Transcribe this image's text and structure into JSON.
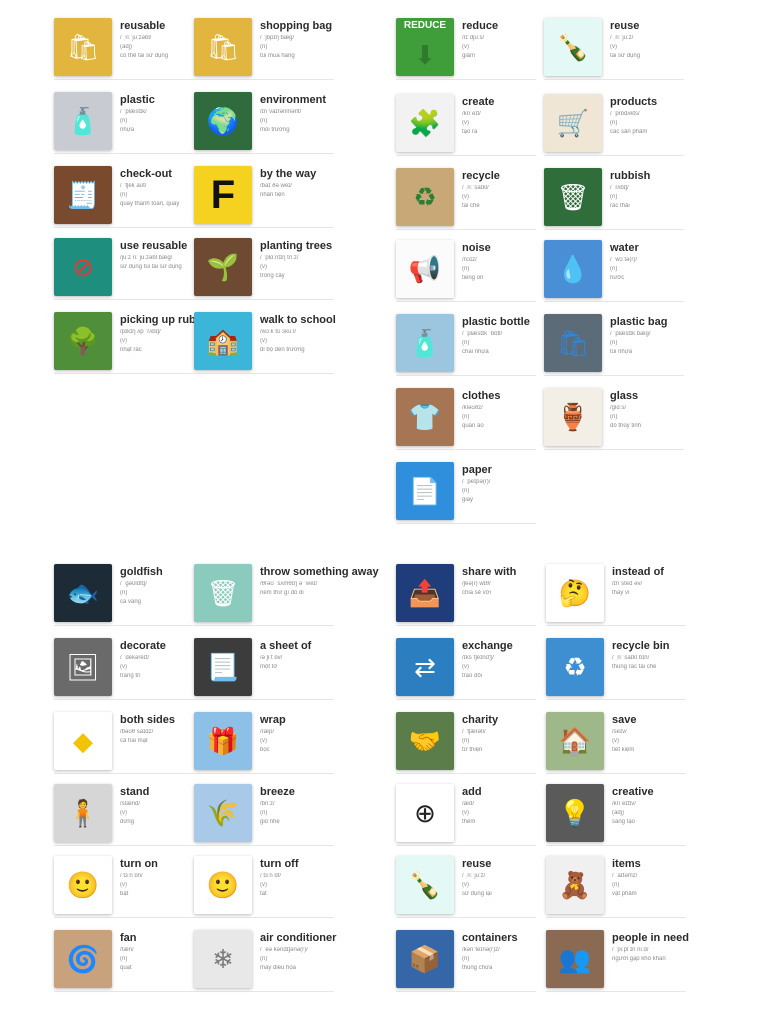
{
  "sections": [
    {
      "name": "section-top-left",
      "cards": [
        {
          "word": "reusable",
          "ipa": "/ ˌriːˈjuːzəbl/",
          "pos": "(adj)",
          "meaning": "có thể tái sử dụng",
          "icon": "shopping-bags-icon",
          "color": "#e2b53e",
          "glyph": "🛍",
          "glyph_color": "#ffffff"
        },
        {
          "word": "shopping bag",
          "ipa": "/ ˈʃɒpɪŋ bæɡ/",
          "pos": "(n)",
          "meaning": "túi mua hàng",
          "icon": "shopping-bags-icon",
          "color": "#e2b53e",
          "glyph": "🛍",
          "glyph_color": "#ffffff"
        },
        {
          "word": "plastic",
          "ipa": "/ ˈplæstɪk/",
          "pos": "(n)",
          "meaning": "nhựa",
          "icon": "plastic-bottles-icon",
          "color": "#c8ccd2",
          "glyph": "🧴",
          "glyph_color": "#3a7bd5"
        },
        {
          "word": "environment",
          "ipa": "/ɪnˈvaɪrənmənt/",
          "pos": "(n)",
          "meaning": "môi trường",
          "icon": "earth-icon",
          "color": "#2f6b3c",
          "glyph": "🌍",
          "glyph_color": "#7fc4ff"
        },
        {
          "word": "check-out",
          "ipa": "/ ˈtʃek aʊt/",
          "pos": "(n)",
          "meaning": "quầy thanh toán, quầy",
          "icon": "checkout-counter-icon",
          "color": "#7a4a2e",
          "glyph": "🧾",
          "glyph_color": "#ffffff"
        },
        {
          "word": "by the way",
          "ipa": "/baɪ ðə weɪ/",
          "pos": "",
          "meaning": "nhân tiện",
          "icon": "letter-f-icon",
          "color": "#f5d21f",
          "glyph": "F",
          "glyph_color": "#111111"
        },
        {
          "word": "use reusable",
          "ipa": "/juːz riːˈjuːzəbl bæɡ/",
          "pos": "",
          "meaning": "sử dụng túi tái sử dụng",
          "icon": "no-plastic-bag-icon",
          "color": "#1e8f7e",
          "glyph": "⊘",
          "glyph_color": "#e53935"
        },
        {
          "word": "planting trees",
          "ipa": "/ ˈplɑːntɪŋ triːz/",
          "pos": "(v)",
          "meaning": "trồng cây",
          "icon": "seedling-icon",
          "color": "#6e4a32",
          "glyph": "🌱",
          "glyph_color": "#6ccf4a"
        },
        {
          "word": "picking up rubbish",
          "ipa": "/pɪkɪŋ ʌp ˈrʌbɪʃ/",
          "pos": "(v)",
          "meaning": "nhặt rác",
          "icon": "park-cleanup-icon",
          "color": "#4f8f3a",
          "glyph": "🌳",
          "glyph_color": "#2e6d22"
        },
        {
          "word": "walk to school",
          "ipa": "/wɔːk tʊ skuːl/",
          "pos": "(v)",
          "meaning": "đi bộ đến trường",
          "icon": "school-children-icon",
          "color": "#3bb5d8",
          "glyph": "🏫",
          "glyph_color": "#ffffff"
        }
      ]
    },
    {
      "name": "section-top-right",
      "cards": [
        {
          "word": "reduce",
          "ipa": "/rɪˈdjuːs/",
          "pos": "(v)",
          "meaning": "giảm",
          "icon": "reduce-arrow-icon",
          "color": "#3f9e3a",
          "glyph": "⬇",
          "glyph_color": "#2f7a2c",
          "label": "REDUCE"
        },
        {
          "word": "reuse",
          "ipa": "/ ˌriːˈjuːz/",
          "pos": "(v)",
          "meaning": "tái sử dụng",
          "icon": "green-bottle-icon",
          "color": "#e4f8f5",
          "glyph": "🍾",
          "glyph_color": "#2e8b57"
        },
        {
          "word": "create",
          "ipa": "/kriˈeɪt/",
          "pos": "(v)",
          "meaning": "tạo ra",
          "icon": "puzzle-icon",
          "color": "#f2f2f2",
          "glyph": "🧩",
          "glyph_color": "#2a9fd6"
        },
        {
          "word": "products",
          "ipa": "/ ˈprɒdʌkts/",
          "pos": "(n)",
          "meaning": "các sản phẩm",
          "icon": "products-icon",
          "color": "#efe6d6",
          "glyph": "🛒",
          "glyph_color": "#c0392b"
        },
        {
          "word": "recycle",
          "ipa": "/ ˌriːˈsaɪkl/",
          "pos": "(v)",
          "meaning": "tái chế",
          "icon": "recycle-box-icon",
          "color": "#c9a878",
          "glyph": "♻",
          "glyph_color": "#2e7d32"
        },
        {
          "word": "rubbish",
          "ipa": "/ ˈrʌbɪʃ/",
          "pos": "(n)",
          "meaning": "rác thải",
          "icon": "trash-bins-icon",
          "color": "#2f6d3a",
          "glyph": "🗑",
          "glyph_color": "#ffffff"
        },
        {
          "word": "noise",
          "ipa": "/nɔɪz/",
          "pos": "(n)",
          "meaning": "tiếng ồn",
          "icon": "noise-icon",
          "color": "#fbfbfb",
          "glyph": "📢",
          "glyph_color": "#e53935"
        },
        {
          "word": "water",
          "ipa": "/ ˈwɔːtə(r)/",
          "pos": "(n)",
          "meaning": "nước",
          "icon": "water-splash-icon",
          "color": "#4a8fd6",
          "glyph": "💧",
          "glyph_color": "#ffffff"
        },
        {
          "word": "plastic bottle",
          "ipa": "/ ˈplæstɪk ˈbɒtl/",
          "pos": "(n)",
          "meaning": "chai nhựa",
          "icon": "plastic-bottle-icon",
          "color": "#9cc6e0",
          "glyph": "🧴",
          "glyph_color": "#ffffff"
        },
        {
          "word": "plastic bag",
          "ipa": "/ ˈplæstɪk bæɡ/",
          "pos": "(n)",
          "meaning": "túi nhựa",
          "icon": "plastic-bag-icon",
          "color": "#5b6b78",
          "glyph": "🛍",
          "glyph_color": "#2e86de"
        },
        {
          "word": "clothes",
          "ipa": "/kləʊðz/",
          "pos": "(n)",
          "meaning": "quần áo",
          "icon": "clothes-icon",
          "color": "#a67654",
          "glyph": "👕",
          "glyph_color": "#ffffff"
        },
        {
          "word": "glass",
          "ipa": "/ɡlɑːs/",
          "pos": "(n)",
          "meaning": "đồ thủy tinh",
          "icon": "glass-jars-icon",
          "color": "#f3efe6",
          "glyph": "🏺",
          "glyph_color": "#b59a72"
        },
        {
          "word": "paper",
          "ipa": "/ ˈpeɪpə(r)/",
          "pos": "(n)",
          "meaning": "giấy",
          "icon": "paper-stack-icon",
          "color": "#2f8fdc",
          "glyph": "📄",
          "glyph_color": "#ffffff"
        }
      ]
    },
    {
      "name": "section-bottom-left",
      "cards": [
        {
          "word": "goldfish",
          "ipa": "/ ˈɡəʊldfɪʃ/",
          "pos": "(n)",
          "meaning": "cá vàng",
          "icon": "goldfish-icon",
          "color": "#1d2b36",
          "glyph": "🐟",
          "glyph_color": "#ff8c1a"
        },
        {
          "word": "throw something away",
          "ipa": "/θrəʊ ˈsʌmθɪŋ ə ˈweɪ/",
          "pos": "",
          "meaning": "ném thứ gì đó đi",
          "icon": "trash-can-icon",
          "color": "#8bcbbe",
          "glyph": "🗑",
          "glyph_color": "#ffffff"
        },
        {
          "word": "decorate",
          "ipa": "/ ˈdekəreɪt/",
          "pos": "(v)",
          "meaning": "trang trí",
          "icon": "decorate-icon",
          "color": "#6a6a6a",
          "glyph": "🖼",
          "glyph_color": "#ffffff"
        },
        {
          "word": "a sheet of",
          "ipa": "/ə ʃiːt ɒv/",
          "pos": "",
          "meaning": "một tờ",
          "icon": "paper-sheet-icon",
          "color": "#3c3c3c",
          "glyph": "📃",
          "glyph_color": "#ffffff"
        },
        {
          "word": "both sides",
          "ipa": "/bəʊθ saɪdz/",
          "pos": "",
          "meaning": "cả hai mặt",
          "icon": "two-way-sign-icon",
          "color": "#ffffff",
          "glyph": "◆",
          "glyph_color": "#f2c300"
        },
        {
          "word": "wrap",
          "ipa": "/ræp/",
          "pos": "(v)",
          "meaning": "bọc",
          "icon": "wrap-icon",
          "color": "#8dc0e6",
          "glyph": "🎁",
          "glyph_color": "#c0392b"
        },
        {
          "word": "stand",
          "ipa": "/stænd/",
          "pos": "(v)",
          "meaning": "đứng",
          "icon": "standing-person-icon",
          "color": "#d6d6d6",
          "glyph": "🧍",
          "glyph_color": "#333333"
        },
        {
          "word": "breeze",
          "ipa": "/briːz/",
          "pos": "(n)",
          "meaning": "gió nhẹ",
          "icon": "breeze-icon",
          "color": "#a9c9e8",
          "glyph": "🌾",
          "glyph_color": "#6b8e23"
        },
        {
          "word": "turn on",
          "ipa": "/ tɜːn ɒn/",
          "pos": "(v)",
          "meaning": "bật",
          "icon": "light-switch-icon",
          "color": "#ffffff",
          "glyph": "🙂",
          "glyph_color": "#2a7bd1"
        },
        {
          "word": "turn off",
          "ipa": "/ tɜːn ɒf/",
          "pos": "(v)",
          "meaning": "tắt",
          "icon": "light-switch-icon",
          "color": "#ffffff",
          "glyph": "🙂",
          "glyph_color": "#2a7bd1"
        },
        {
          "word": "fan",
          "ipa": "/fæn/",
          "pos": "(n)",
          "meaning": "quạt",
          "icon": "fan-icon",
          "color": "#c7a27c",
          "glyph": "🌀",
          "glyph_color": "#222222"
        },
        {
          "word": "air conditioner",
          "ipa": "/ ˈeə kəndɪʃənə(r)/",
          "pos": "(n)",
          "meaning": "máy điều hòa",
          "icon": "air-conditioner-icon",
          "color": "#e8e8e8",
          "glyph": "❄",
          "glyph_color": "#7a7a7a"
        }
      ]
    },
    {
      "name": "section-bottom-right",
      "cards": [
        {
          "word": "share with",
          "ipa": "/ʃeə(r) wɪθ/",
          "pos": "",
          "meaning": "chia sẻ với",
          "icon": "share-screen-icon",
          "color": "#1f3d7a",
          "glyph": "📤",
          "glyph_color": "#ffffff"
        },
        {
          "word": "instead of",
          "ipa": "/ɪnˈsted əv/",
          "pos": "",
          "meaning": "thay vì",
          "icon": "thinking-person-icon",
          "color": "#ffffff",
          "glyph": "🤔",
          "glyph_color": "#555555"
        },
        {
          "word": "exchange",
          "ipa": "/ɪksˈtʃeɪndʒ/",
          "pos": "(v)",
          "meaning": "trao đổi",
          "icon": "exchange-icon",
          "color": "#2b7fc0",
          "glyph": "⇄",
          "glyph_color": "#ffffff"
        },
        {
          "word": "recycle bin",
          "ipa": "/ ˌriːˈsaɪkl bɪn/",
          "pos": "",
          "meaning": "thùng rác tái chế",
          "icon": "recycle-bins-icon",
          "color": "#3d8fd1",
          "glyph": "♻",
          "glyph_color": "#ffffff"
        },
        {
          "word": "charity",
          "ipa": "/ ˈtʃærəti/",
          "pos": "(n)",
          "meaning": "từ thiện",
          "icon": "charity-icon",
          "color": "#5a7d4a",
          "glyph": "🤝",
          "glyph_color": "#ffffff"
        },
        {
          "word": "save",
          "ipa": "/seɪv/",
          "pos": "(v)",
          "meaning": "tiết kiệm",
          "icon": "piggy-house-icon",
          "color": "#9fb88a",
          "glyph": "🏠",
          "glyph_color": "#ffffff"
        },
        {
          "word": "add",
          "ipa": "/æd/",
          "pos": "(v)",
          "meaning": "thêm",
          "icon": "plus-circle-icon",
          "color": "#ffffff",
          "glyph": "⊕",
          "glyph_color": "#222222"
        },
        {
          "word": "creative",
          "ipa": "/kriˈeɪtɪv/",
          "pos": "(adj)",
          "meaning": "sáng tạo",
          "icon": "lightbulb-icon",
          "color": "#5a5a5a",
          "glyph": "💡",
          "glyph_color": "#ffd54f"
        },
        {
          "word": "reuse",
          "ipa": "/ ˌriːˈjuːz/",
          "pos": "(v)",
          "meaning": "sử dụng lại",
          "icon": "green-bottle-icon",
          "color": "#e4f8f5",
          "glyph": "🍾",
          "glyph_color": "#2e8b57"
        },
        {
          "word": "items",
          "ipa": "/ ˈaɪtəmz/",
          "pos": "(n)",
          "meaning": "vật phẩm",
          "icon": "items-icon",
          "color": "#f0f0f0",
          "glyph": "🧸",
          "glyph_color": "#c0392b"
        },
        {
          "word": "containers",
          "ipa": "/kənˈteɪnə(r)z/",
          "pos": "(n)",
          "meaning": "thùng chứa",
          "icon": "shipping-containers-icon",
          "color": "#3567a8",
          "glyph": "📦",
          "glyph_color": "#d9822b"
        },
        {
          "word": "people in need",
          "ipa": "/ ˈpiːpl ɪn niːd/",
          "pos": "",
          "meaning": "người gặp khó khăn",
          "icon": "people-in-need-icon",
          "color": "#8a6a52",
          "glyph": "👥",
          "glyph_color": "#ffffff"
        }
      ]
    }
  ]
}
